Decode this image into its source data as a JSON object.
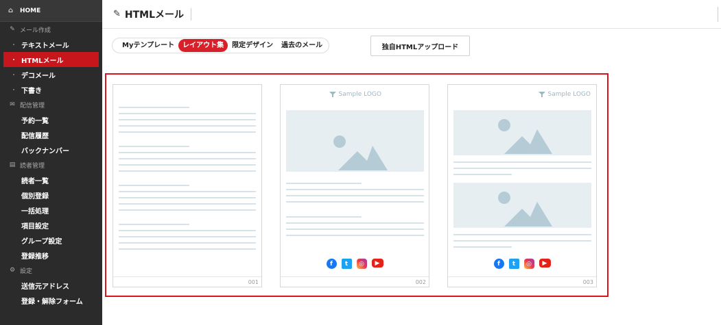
{
  "sidebar": {
    "home": "HOME",
    "sections": [
      {
        "label": "メール作成",
        "icon": "pencil-icon",
        "items": [
          {
            "label": "テキストメール",
            "active": false
          },
          {
            "label": "HTMLメール",
            "active": true
          },
          {
            "label": "デコメール",
            "active": false
          },
          {
            "label": "下書き",
            "active": false
          }
        ]
      },
      {
        "label": "配信管理",
        "icon": "mail-icon",
        "items": [
          {
            "label": "予約一覧"
          },
          {
            "label": "配信履歴"
          },
          {
            "label": "バックナンバー"
          }
        ]
      },
      {
        "label": "読者管理",
        "icon": "database-icon",
        "items": [
          {
            "label": "読者一覧"
          },
          {
            "label": "個別登録"
          },
          {
            "label": "一括処理"
          },
          {
            "label": "項目設定"
          },
          {
            "label": "グループ設定"
          },
          {
            "label": "登録推移"
          }
        ]
      },
      {
        "label": "設定",
        "icon": "gear-icon",
        "items": [
          {
            "label": "送信元アドレス"
          },
          {
            "label": "登録・解除フォーム"
          }
        ]
      }
    ]
  },
  "header": {
    "title": "HTMLメール"
  },
  "tabs": [
    {
      "label": "Myテンプレート",
      "active": false
    },
    {
      "label": "レイアウト集",
      "active": true
    },
    {
      "label": "限定デザイン",
      "active": false
    },
    {
      "label": "過去のメール",
      "active": false
    }
  ],
  "upload_button": "独自HTMLアップロード",
  "layouts": [
    {
      "number": "001"
    },
    {
      "number": "002",
      "logo": "Sample LOGO"
    },
    {
      "number": "003",
      "logo": "Sample LOGO"
    }
  ],
  "colors": {
    "accent": "#d8202a",
    "sidebar_bg": "#2b2b2b",
    "placeholder": "#e6eef1",
    "line": "#d6e4ea",
    "mountain": "#b5ccd6"
  },
  "social_icons": [
    "facebook-icon",
    "twitter-icon",
    "instagram-icon",
    "youtube-icon"
  ]
}
